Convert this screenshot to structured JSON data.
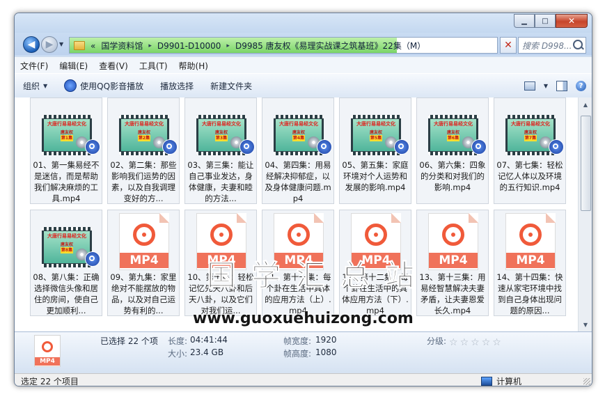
{
  "window": {
    "minimize": "▁",
    "maximize": "□",
    "close": "✕"
  },
  "nav": {
    "back": "◀",
    "forward": "▶",
    "dropdown": "▼",
    "crumb_prefix": "«",
    "crumbs": [
      "国学资料馆",
      "D9901-D10000",
      "D9985 唐友权《易理实战课之筑基班》22集（M）"
    ],
    "crumb_sep": "▸",
    "search_placeholder": "搜索 D998..."
  },
  "menu": {
    "items": [
      "文件(F)",
      "编辑(E)",
      "查看(V)",
      "工具(T)",
      "帮助(H)"
    ]
  },
  "toolbar": {
    "organize": "组织",
    "play_qq": "使用QQ影音播放",
    "play_selection": "播放选择",
    "new_folder": "新建文件夹",
    "help": "?"
  },
  "thumbnail_text": {
    "title": "大唐行易易经文化",
    "sub": "唐友权"
  },
  "files": [
    {
      "label": "01、第一集易经不是迷信，而是帮助我们解决麻烦的工具.mp4",
      "kind": "video",
      "ep": "第1集"
    },
    {
      "label": "02、第二集：那些影响我们运势的因素，以及自我调理变好的方...",
      "kind": "video",
      "ep": "第2集"
    },
    {
      "label": "03、第三集：能让自己事业发达，身体健康，夫妻和睦的方法...",
      "kind": "video",
      "ep": "第3集"
    },
    {
      "label": "04、第四集：用易经解决抑郁症，以及身体健康问题.mp4",
      "kind": "video",
      "ep": "第4集"
    },
    {
      "label": "05、第五集：家庭环境对个人运势和发展的影响.mp4",
      "kind": "video",
      "ep": "第5集"
    },
    {
      "label": "06、第六集：四象的分类和对我们的影响.mp4",
      "kind": "video",
      "ep": "第6集"
    },
    {
      "label": "07、第七集：轻松记忆人体以及环境的五行知识.mp4",
      "kind": "video",
      "ep": "第7集"
    },
    {
      "label": "08、第八集：正确选择微信头像和居住的房间，使自己更加顺利...",
      "kind": "video",
      "ep": "第8集"
    },
    {
      "label": "09、第九集：家里绝对不能摆放的物品，以及对自己运势有利的...",
      "kind": "mp4",
      "ep": ""
    },
    {
      "label": "10、第十集：轻松记忆先天八卦和后天八卦，以及它们对我们运...",
      "kind": "mp4",
      "ep": ""
    },
    {
      "label": "11、第十一集：每个卦在生活中具体的应用方法（上）.mp4",
      "kind": "mp4",
      "ep": ""
    },
    {
      "label": "12、第十二集：每个卦在生活中的具体应用方法（下）.mp4",
      "kind": "mp4",
      "ep": ""
    },
    {
      "label": "13、第十三集：用易经智慧解决夫妻矛盾，让夫妻恩爱长久.mp4",
      "kind": "mp4",
      "ep": ""
    },
    {
      "label": "14、第十四集：快速从家宅环境中找到自己身体出现问题的原因...",
      "kind": "mp4",
      "ep": ""
    }
  ],
  "mp4_badge": "MP4",
  "watermark": {
    "cn": "国学汇总站",
    "url": "www.guoxuehuizong.com"
  },
  "details": {
    "selected": "已选择 22 个项",
    "duration_label": "长度:",
    "duration": "04:41:44",
    "size_label": "大小:",
    "size": "23.4 GB",
    "frame_width_label": "帧宽度:",
    "frame_width": "1920",
    "frame_height_label": "帧高度:",
    "frame_height": "1080",
    "rating_label": "分级:",
    "rating": 0,
    "stars": [
      "☆",
      "☆",
      "☆",
      "☆",
      "☆"
    ]
  },
  "status": {
    "left": "选定 22 个项目",
    "right": "计算机"
  }
}
